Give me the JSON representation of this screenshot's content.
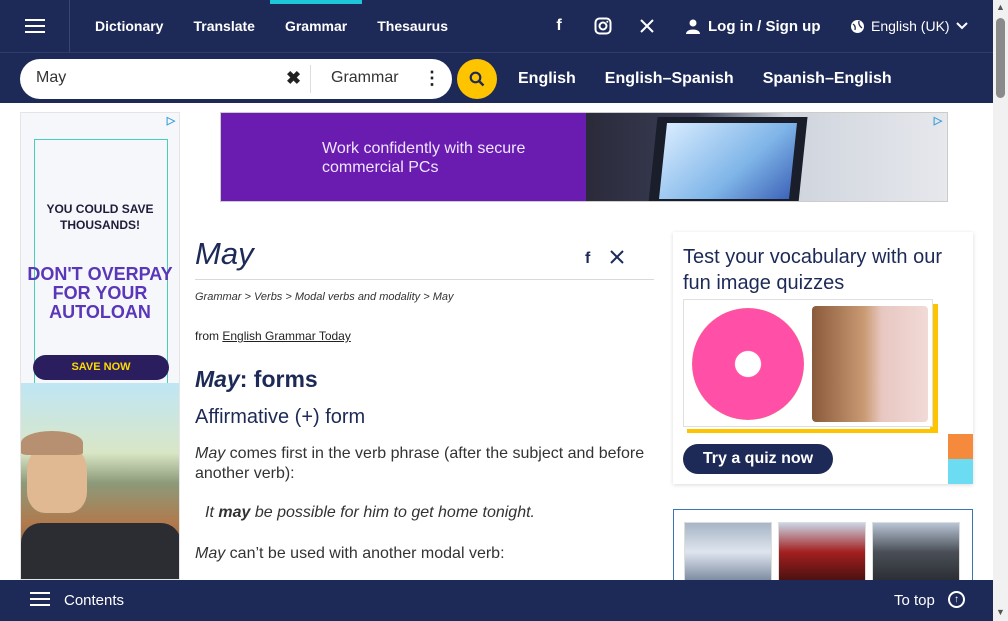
{
  "nav": {
    "links": [
      "Dictionary",
      "Translate",
      "Grammar",
      "Thesaurus"
    ],
    "active": "Grammar",
    "login_label": "Log in / Sign up",
    "language_label": "English (UK)"
  },
  "search": {
    "query": "May",
    "dictionary_label": "Grammar",
    "dict_links": [
      "English",
      "English–Spanish",
      "Spanish–English"
    ]
  },
  "left_ad": {
    "line1": "YOU COULD SAVE THOUSANDS!",
    "line2": "DON'T OVERPAY FOR YOUR AUTOLOAN",
    "button": "SAVE NOW"
  },
  "banner_ad": {
    "text": "Work confidently with secure commercial PCs"
  },
  "article": {
    "title": "May",
    "breadcrumb": "Grammar > Verbs > Modal verbs and modality > May",
    "from_prefix": "from",
    "from_source": "English Grammar Today",
    "heading_word": "May",
    "heading_rest": ": forms",
    "subheading": "Affirmative (+) form",
    "para1_word": "May",
    "para1_rest": " comes first in the verb phrase (after the subject and before another verb):",
    "example_pre": "It ",
    "example_bold": "may",
    "example_post": " be possible for him to get home tonight.",
    "para2_word": "May",
    "para2_rest": " can’t be used with another modal verb:"
  },
  "quiz": {
    "title": "Test your vocabulary with our fun image quizzes",
    "button": "Try a quiz now"
  },
  "bottom": {
    "contents_label": "Contents",
    "totop_label": "To top"
  },
  "colors": {
    "navy": "#1d2a57",
    "accent": "#fec400",
    "tab_indicator": "#1fc5d8"
  }
}
